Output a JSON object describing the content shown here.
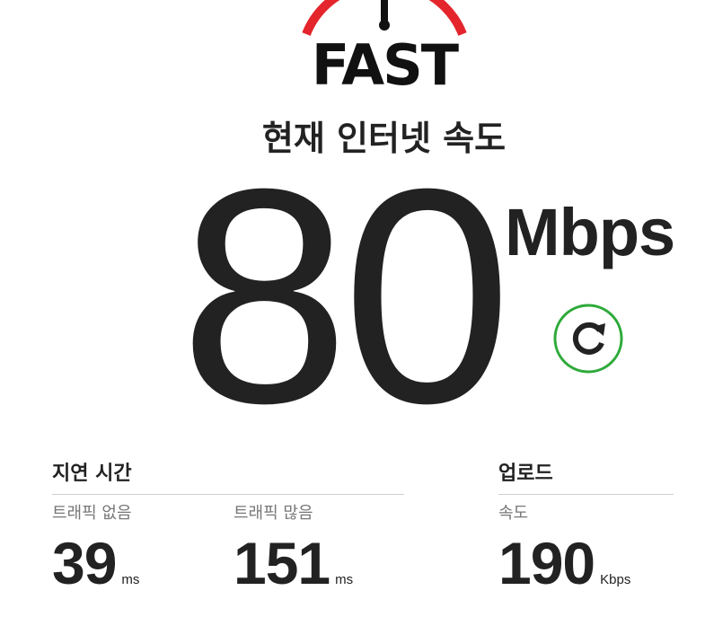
{
  "logo": {
    "text": "FAST",
    "color": "#e4252c"
  },
  "heading": "현재 인터넷 속도",
  "speed": {
    "value": "80",
    "units": "Mbps"
  },
  "refresh": {
    "icon": "refresh-icon",
    "color": "#2eaa3a"
  },
  "latency": {
    "title": "지연 시간",
    "unloaded": {
      "label": "트래픽 없음",
      "value": "39",
      "unit": "ms"
    },
    "loaded": {
      "label": "트래픽 많음",
      "value": "151",
      "unit": "ms"
    }
  },
  "upload": {
    "title": "업로드",
    "speed": {
      "label": "속도",
      "value": "190",
      "unit": "Kbps"
    }
  }
}
